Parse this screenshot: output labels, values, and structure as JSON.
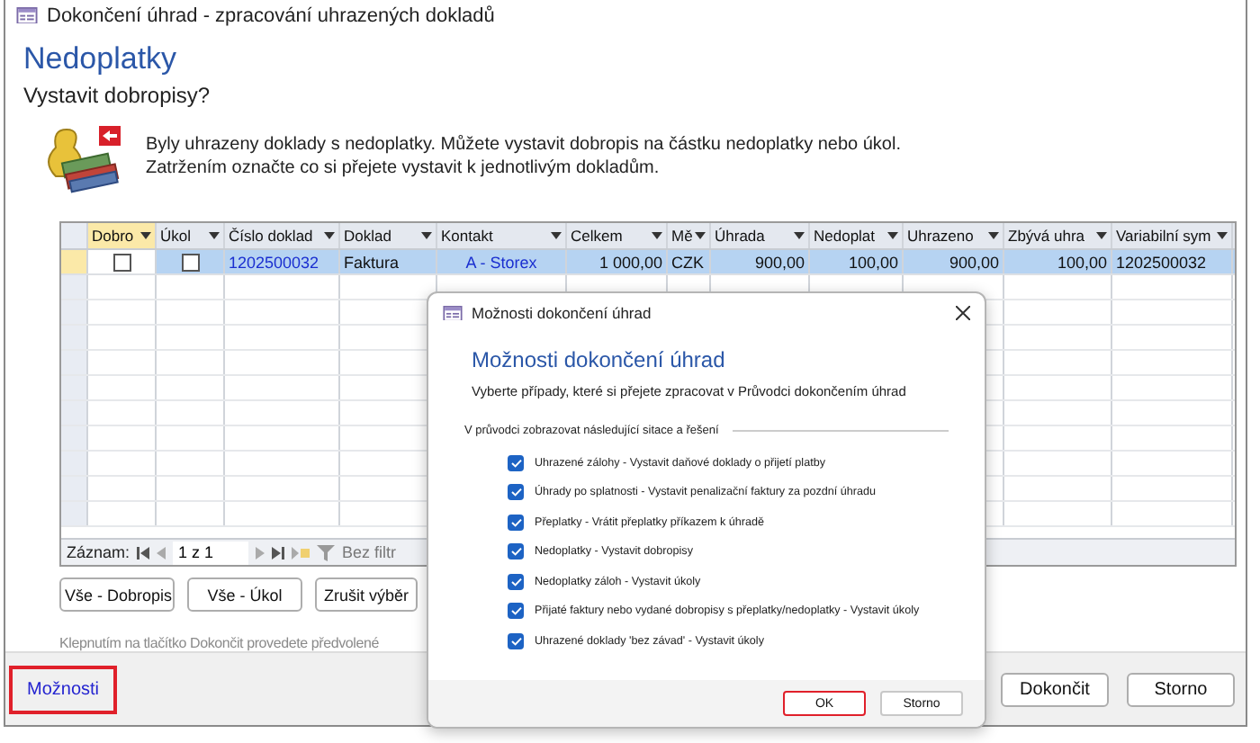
{
  "window": {
    "title": "Dokončení úhrad - zpracování uhrazených dokladů"
  },
  "heading": "Nedoplatky",
  "subheading": "Vystavit dobropisy?",
  "message_lines": [
    "Byly uhrazeny doklady s nedoplatky. Můžete vystavit dobropis na částku nedoplatky nebo úkol.",
    "Zatržením označte co si přejete vystavit k jednotlivým dokladům."
  ],
  "grid": {
    "columns": [
      {
        "label": "Dobro",
        "selected": true
      },
      {
        "label": "Úkol",
        "selected": false
      },
      {
        "label": "Číslo doklad",
        "selected": false
      },
      {
        "label": "Doklad",
        "selected": false
      },
      {
        "label": "Kontakt",
        "selected": false
      },
      {
        "label": "Celkem",
        "selected": false
      },
      {
        "label": "Mě",
        "selected": false
      },
      {
        "label": "Úhrada",
        "selected": false
      },
      {
        "label": "Nedoplat",
        "selected": false
      },
      {
        "label": "Uhrazeno",
        "selected": false
      },
      {
        "label": "Zbývá uhra",
        "selected": false
      },
      {
        "label": "Variabilní sym",
        "selected": false
      }
    ],
    "rows": [
      {
        "selected": true,
        "cells": [
          {
            "kind": "checkbox",
            "checked": false
          },
          {
            "kind": "checkbox",
            "checked": false
          },
          {
            "kind": "link",
            "text": "1202500032"
          },
          {
            "kind": "text",
            "text": "Faktura"
          },
          {
            "kind": "link",
            "text": "A - Storex"
          },
          {
            "kind": "text",
            "text": "1 000,00"
          },
          {
            "kind": "text",
            "text": "CZK"
          },
          {
            "kind": "text",
            "text": "900,00"
          },
          {
            "kind": "text",
            "text": "100,00"
          },
          {
            "kind": "text",
            "text": "900,00"
          },
          {
            "kind": "text",
            "text": "100,00"
          },
          {
            "kind": "text",
            "text": "1202500032"
          }
        ]
      }
    ],
    "navigator": {
      "label": "Záznam:",
      "position": "1 z 1",
      "filter": "Bez filtr"
    }
  },
  "action_buttons": [
    "Vše - Dobropis",
    "Vše - Úkol",
    "Zrušit výběr"
  ],
  "hint": "Klepnutím na tlačítko Dokončit provedete předvolené",
  "footer": {
    "options_link": {
      "label": "Možnosti",
      "highlighted": true
    },
    "buttons": [
      "Dokončit",
      "Storno"
    ]
  },
  "dialog": {
    "title": "Možnosti dokončení úhrad",
    "heading": "Možnosti dokončení úhrad",
    "subtitle": "Vyberte případy, které si přejete zpracovat v Průvodci dokončením úhrad",
    "section": "V průvodci zobrazovat následující sitace a řešení",
    "options": [
      {
        "label": "Uhrazené zálohy - Vystavit daňové doklady o přijetí platby",
        "checked": true
      },
      {
        "label": "Úhrady po splatnosti - Vystavit penalizační faktury za pozdní úhradu",
        "checked": true
      },
      {
        "label": "Přeplatky - Vrátit přeplatky příkazem k úhradě",
        "checked": true
      },
      {
        "label": "Nedoplatky - Vystavit dobropisy",
        "checked": true
      },
      {
        "label": "Nedoplatky záloh - Vystavit úkoly",
        "checked": true
      },
      {
        "label": "Přijaté faktury nebo vydané dobropisy s přeplatky/nedoplatky - Vystavit úkoly",
        "checked": true
      },
      {
        "label": "Uhrazené doklady 'bez závad' - Vystavit úkoly",
        "checked": true
      }
    ],
    "buttons": [
      {
        "label": "OK",
        "highlighted": true
      },
      {
        "label": "Storno",
        "highlighted": false
      }
    ]
  }
}
